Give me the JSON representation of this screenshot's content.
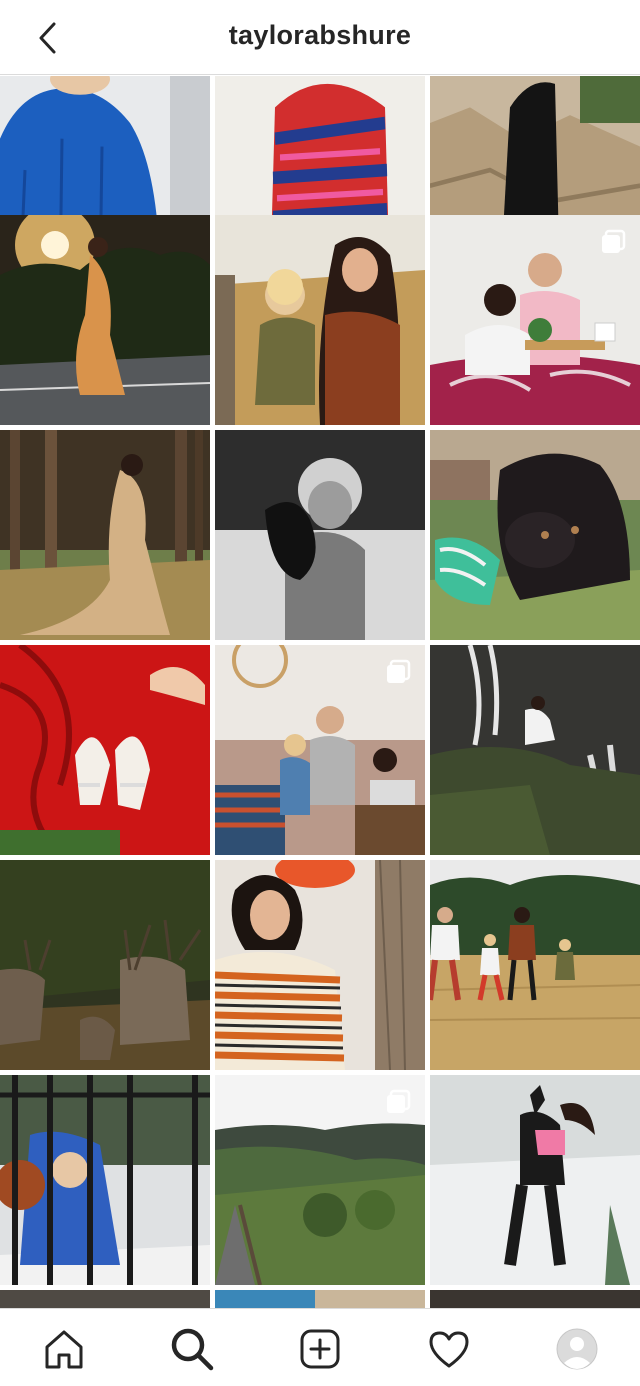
{
  "header": {
    "username": "taylorabshure",
    "back_icon": "chevron-left-icon"
  },
  "grid": {
    "columns": 3,
    "tiles": [
      {
        "name": "child-blue-jacket",
        "multi": false
      },
      {
        "name": "colorful-knit-sweater",
        "multi": false
      },
      {
        "name": "woman-on-rocks",
        "multi": false
      },
      {
        "name": "sunset-dress-road",
        "multi": false
      },
      {
        "name": "mother-and-son-laughing",
        "multi": false
      },
      {
        "name": "couple-breakfast-in-bed",
        "multi": true
      },
      {
        "name": "forest-gown",
        "multi": false
      },
      {
        "name": "child-with-puppy-bw",
        "multi": false
      },
      {
        "name": "black-puppy-grass",
        "multi": false
      },
      {
        "name": "red-dress-heels",
        "multi": false
      },
      {
        "name": "family-laptop-couch",
        "multi": true
      },
      {
        "name": "woman-at-waterfall",
        "multi": false
      },
      {
        "name": "deer-in-woods",
        "multi": false
      },
      {
        "name": "striped-shirt-woman",
        "multi": false
      },
      {
        "name": "family-running-field",
        "multi": false
      },
      {
        "name": "child-at-fence",
        "multi": false
      },
      {
        "name": "foggy-mountain-valley",
        "multi": true
      },
      {
        "name": "woman-in-snow",
        "multi": false
      },
      {
        "name": "partial-row-1",
        "multi": false
      },
      {
        "name": "partial-row-2",
        "multi": false
      },
      {
        "name": "partial-row-3",
        "multi": false
      }
    ]
  },
  "bottom_nav": [
    {
      "name": "home-icon"
    },
    {
      "name": "search-icon"
    },
    {
      "name": "new-post-icon"
    },
    {
      "name": "heart-icon"
    },
    {
      "name": "profile-avatar-icon"
    }
  ],
  "colors": {
    "text": "#262626",
    "border": "#dbdbdb",
    "background": "#ffffff"
  }
}
